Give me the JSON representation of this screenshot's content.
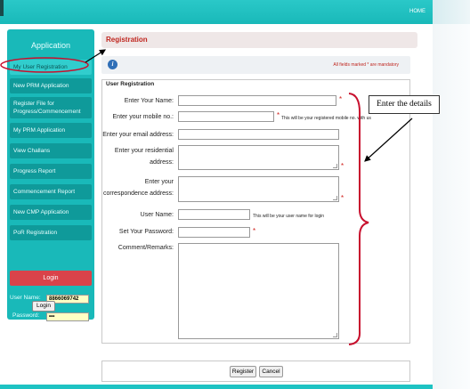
{
  "header": {
    "home": "HOME"
  },
  "sidebar": {
    "title": "Application",
    "items": [
      {
        "label": "My User Registration",
        "active": true
      },
      {
        "label": "New PRM Application"
      },
      {
        "label": "Register File for Progress/Commencement"
      },
      {
        "label": "My PRM Application"
      },
      {
        "label": "View Challans"
      },
      {
        "label": "Progress Report"
      },
      {
        "label": "Commencement Report"
      },
      {
        "label": "New CMP Application"
      },
      {
        "label": "PoR Registration"
      }
    ],
    "login_title": "Login",
    "username_label": "User Name:",
    "username_value": "8866069742",
    "password_label": "Password:",
    "password_value": "•••",
    "login_button": "Login"
  },
  "registration": {
    "title": "Registration",
    "mandatory_note": "All fields marked * are mandatory",
    "section_title": "User Registration"
  },
  "form": {
    "name_label": "Enter Your Name:",
    "mobile_label": "Enter your mobile no.:",
    "mobile_hint": "This will be your registered mobile no. with us",
    "email_label": "Enter your email address:",
    "residential_label_1": "Enter your residential",
    "residential_label_2": "address:",
    "corr_label_1": "Enter your",
    "corr_label_2": "correspondence address:",
    "username_label": "User Name:",
    "username_hint": "This will be your user name for login",
    "password_label": "Set Your Password:",
    "comment_label": "Comment/Remarks:",
    "required_mark": "*"
  },
  "buttons": {
    "register": "Register",
    "cancel": "Cancel"
  },
  "annotation": {
    "callout": "Enter the details",
    "color": "#c8102e"
  },
  "colors": {
    "teal": "#1ec3c3",
    "sidebar_item": "#0f9a9a",
    "login_red": "#d9434a",
    "title_red": "#c0261f"
  }
}
